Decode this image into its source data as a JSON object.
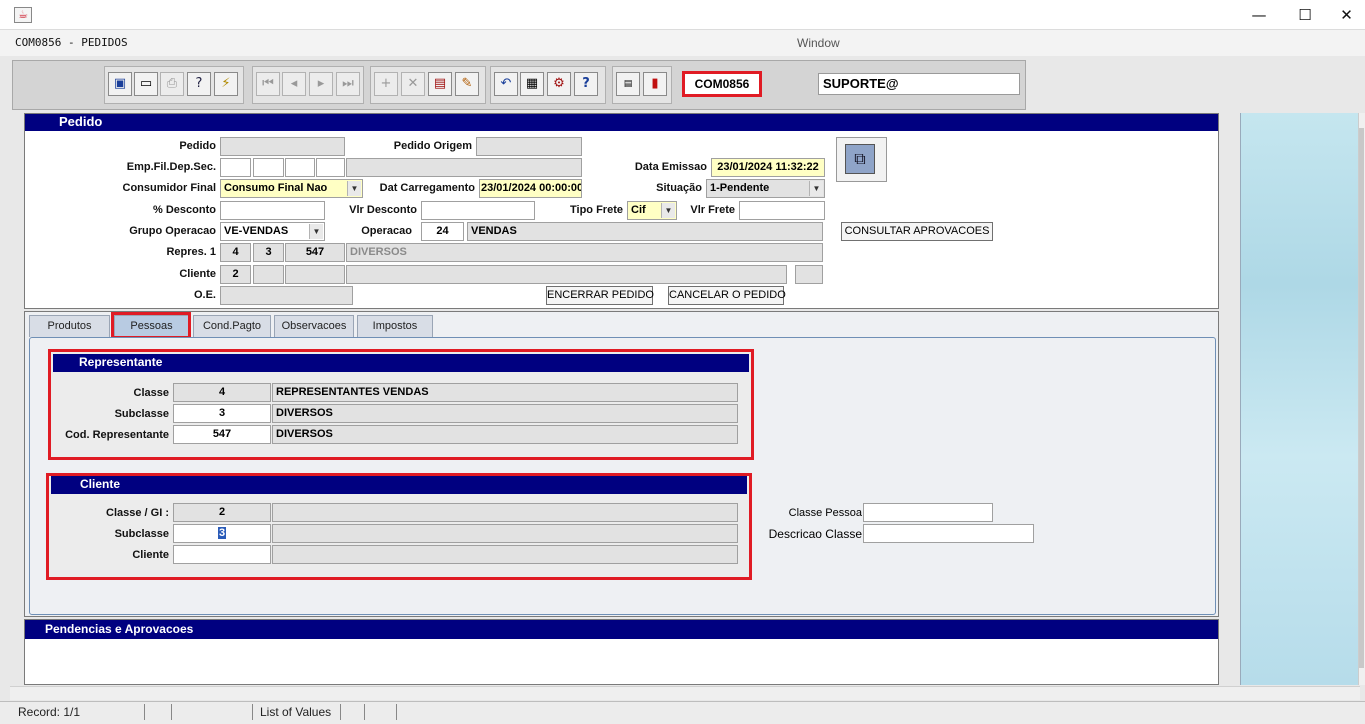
{
  "window": {
    "title": "COM0856 - PEDIDOS",
    "menu_window": "Window",
    "minimize": "—",
    "maximize": "☐",
    "close": "✕"
  },
  "toolbar": {
    "form_code": "COM0856",
    "user": "SUPORTE@"
  },
  "pedido": {
    "header": "Pedido",
    "labels": {
      "pedido": "Pedido",
      "pedido_origem": "Pedido Origem",
      "emp_fil": "Emp.Fil.Dep.Sec.",
      "data_emissao": "Data Emissao",
      "consumidor_final": "Consumidor Final",
      "dat_carregamento": "Dat Carregamento",
      "situacao": "Situação",
      "pct_desconto": "% Desconto",
      "vlr_desconto": "Vlr Desconto",
      "tipo_frete": "Tipo Frete",
      "vlr_frete": "Vlr Frete",
      "grupo_operacao": "Grupo Operacao",
      "operacao": "Operacao",
      "repres1": "Repres. 1",
      "cliente": "Cliente",
      "oe": "O.E."
    },
    "values": {
      "data_emissao": "23/01/2024 11:32:22",
      "consumidor_final": "Consumo Final Nao",
      "dat_carregamento": "23/01/2024 00:00:00",
      "situacao": "1-Pendente",
      "tipo_frete": "Cif",
      "grupo_operacao": "VE-VENDAS",
      "operacao_code": "24",
      "operacao_desc": "VENDAS",
      "repres_a": "4",
      "repres_b": "3",
      "repres_c": "547",
      "repres_desc": "DIVERSOS",
      "cliente_a": "2"
    },
    "buttons": {
      "consultar": "CONSULTAR APROVACOES",
      "encerrar": "ENCERRAR PEDIDO",
      "cancelar": "CANCELAR O PEDIDO"
    }
  },
  "tabs": [
    {
      "label": "Produtos"
    },
    {
      "label": "Pessoas"
    },
    {
      "label": "Cond.Pagto"
    },
    {
      "label": "Observacoes"
    },
    {
      "label": "Impostos"
    }
  ],
  "representante": {
    "header": "Representante",
    "rows": [
      {
        "label": "Classe",
        "code": "4",
        "desc": "REPRESENTANTES VENDAS"
      },
      {
        "label": "Subclasse",
        "code": "3",
        "desc": "DIVERSOS"
      },
      {
        "label": "Cod. Representante",
        "code": "547",
        "desc": "DIVERSOS"
      }
    ]
  },
  "cliente": {
    "header": "Cliente",
    "rows": [
      {
        "label": "Classe / GI :",
        "code": "2",
        "desc": ""
      },
      {
        "label": "Subclasse",
        "code": "3",
        "desc": ""
      },
      {
        "label": "Cliente",
        "code": "",
        "desc": ""
      }
    ],
    "classe_pessoa_label": "Classe Pessoa",
    "descricao_classe_label": "Descricao Classe"
  },
  "pendencias": {
    "header": "Pendencias e Aprovacoes"
  },
  "status": {
    "record": "Record: 1/1",
    "lov": "List of Values"
  }
}
